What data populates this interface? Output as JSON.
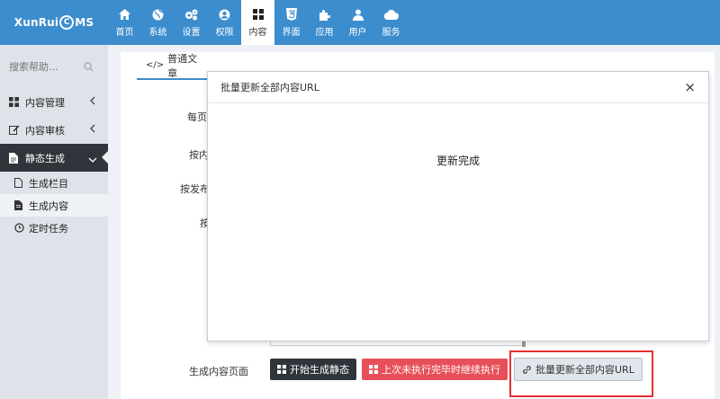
{
  "header": {
    "logo_left": "XunRui",
    "logo_mid": "C",
    "logo_right": "MS",
    "nav": [
      {
        "label": "首页",
        "icon": "home-icon"
      },
      {
        "label": "系统",
        "icon": "globe-icon"
      },
      {
        "label": "设置",
        "icon": "gears-icon"
      },
      {
        "label": "权限",
        "icon": "user-circle-icon"
      },
      {
        "label": "内容",
        "icon": "grid-icon"
      },
      {
        "label": "界面",
        "icon": "html5-icon"
      },
      {
        "label": "应用",
        "icon": "puzzle-icon"
      },
      {
        "label": "用户",
        "icon": "user-icon"
      },
      {
        "label": "服务",
        "icon": "cloud-icon"
      }
    ],
    "active_nav": "内容"
  },
  "sidebar": {
    "search_placeholder": "搜索帮助...",
    "items": [
      {
        "label": "内容管理"
      },
      {
        "label": "内容审核"
      },
      {
        "label": "静态生成"
      }
    ],
    "sub_items": [
      {
        "label": "生成栏目"
      },
      {
        "label": "生成内容"
      },
      {
        "label": "定时任务"
      }
    ]
  },
  "main": {
    "tab_label": "普通文章",
    "row_labels": [
      "每页",
      "按内",
      "按发布",
      "按"
    ],
    "bottom_label": "生成内容页面",
    "buttons": {
      "start": "开始生成静态",
      "resume": "上次未执行完毕时继续执行",
      "update_url": "批量更新全部内容URL"
    }
  },
  "modal": {
    "title": "批量更新全部内容URL",
    "close": "×",
    "message": "更新完成"
  },
  "colors": {
    "topbar": "#3c8dce",
    "sidebar_active": "#2f353b",
    "danger": "#e7505a",
    "highlight": "#e53030"
  }
}
